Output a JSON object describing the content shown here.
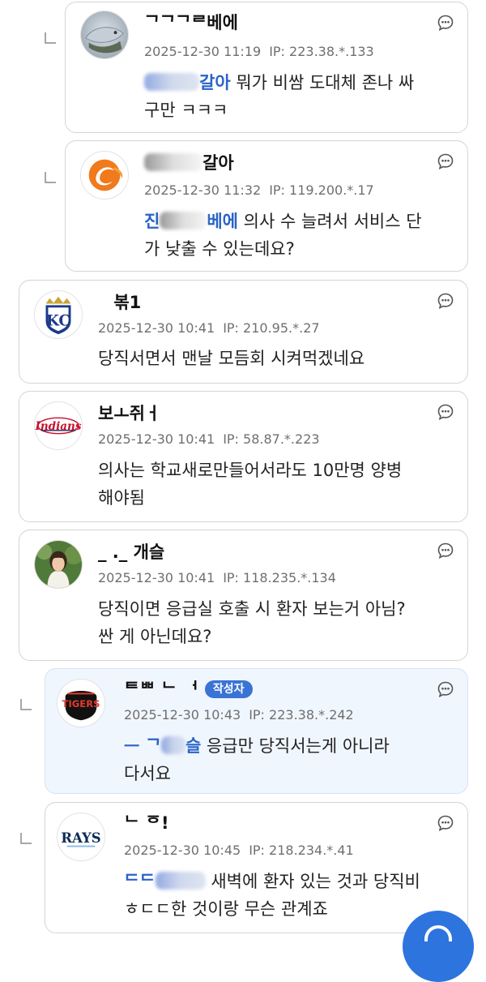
{
  "comments": [
    {
      "nickname": "ᄀᄀᄀᄅ베에",
      "date": "2025-12-30 11:19",
      "ip": "IP: 223.38.*.133",
      "mention": "갈아",
      "text_line1": " 뭐가 비쌈 도대체 존나 싸",
      "text_line2": "구만 ㅋㅋㅋ"
    },
    {
      "nickname": "갈아",
      "date": "2025-12-30 11:32",
      "ip": "IP: 119.200.*.17",
      "mention_a": "진",
      "mention_b": "베에",
      "text_line1": " 의사 수 늘려서 서비스 단",
      "text_line2": "가 낮출 수 있는데요?"
    },
    {
      "nickname": "ᅟ볶1",
      "date": "2025-12-30 10:41",
      "ip": "IP: 210.95.*.27",
      "text_line1": "당직서면서 맨날 모듬회 시켜먹겠네요"
    },
    {
      "nickname": "보ㅗ쥐ㅓ",
      "date": "2025-12-30 10:41",
      "ip": "IP: 58.87.*.223",
      "text_line1": "의사는 학교새로만들어서라도 10만명 양병",
      "text_line2": "해야됨"
    },
    {
      "nickname": "_ ._ 개슬",
      "date": "2025-12-30 10:41",
      "ip": "IP: 118.235.*.134",
      "text_line1": "당직이면 응급실 호출 시 환자 보는거 아님?",
      "text_line2": "싼 게 아닌데요?"
    },
    {
      "nickname": "ᄐᄈ ᄂ ᅥ",
      "badge": "작성자",
      "date": "2025-12-30 10:43",
      "ip": "IP: 223.38.*.242",
      "mention_a": "ᅳ ᄀ",
      "mention_b": "슬",
      "text_line1": " 응급만 당직서는게 아니라",
      "text_line2": "다서요"
    },
    {
      "nickname": "ᄂ ᅙ!",
      "date": "2025-12-30 10:45",
      "ip": "IP: 218.234.*.41",
      "mention_a": "ᄃᄃ",
      "text_line1": " 새벽에 환자 있는 것과 당직비",
      "text_line2": "ㅎㄷㄷ한 것이랑 무슨 관계죠"
    }
  ],
  "avatars": [
    "fish-photo",
    "orange-logo",
    "kc-royals-logo",
    "indians-logo",
    "woman-photo",
    "tigers-logo",
    "rays-logo"
  ],
  "colors": {
    "mention": "#2a63c8",
    "badge": "#3a73d6",
    "fab": "#2d74df",
    "op_card": "#f0f6fd"
  }
}
